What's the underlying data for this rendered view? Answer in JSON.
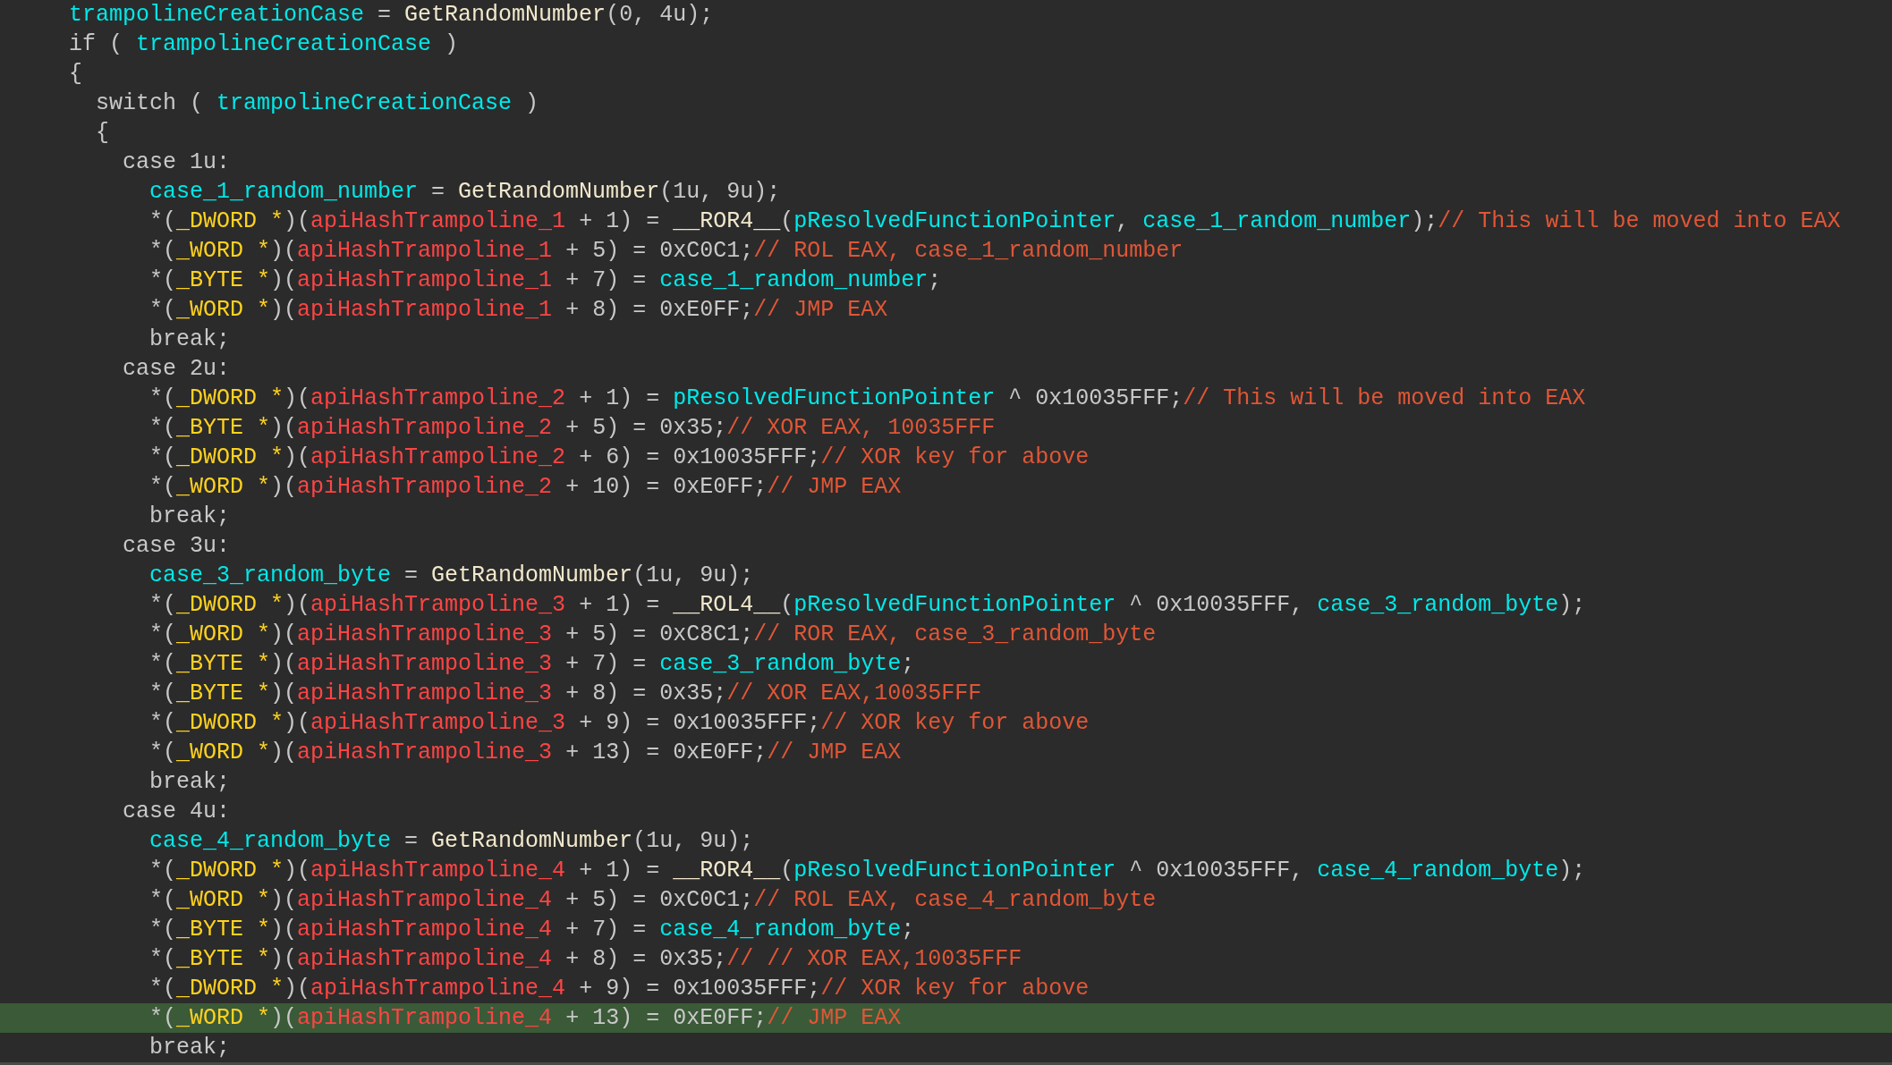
{
  "code_lines": [
    {
      "highlighted": false,
      "tokens": [
        {
          "kind": "var",
          "text": "trampolineCreationCase"
        },
        {
          "kind": "plain",
          "text": " = "
        },
        {
          "kind": "func",
          "text": "GetRandomNumber"
        },
        {
          "kind": "plain",
          "text": "(0, 4u);"
        }
      ]
    },
    {
      "highlighted": false,
      "tokens": [
        {
          "kind": "plain",
          "text": "if ( "
        },
        {
          "kind": "var",
          "text": "trampolineCreationCase"
        },
        {
          "kind": "plain",
          "text": " )"
        }
      ]
    },
    {
      "highlighted": false,
      "tokens": [
        {
          "kind": "plain",
          "text": "{"
        }
      ],
      "children": [
        {
          "highlighted": false,
          "tokens": [
            {
              "kind": "plain",
              "text": "switch ( "
            },
            {
              "kind": "var",
              "text": "trampolineCreationCase"
            },
            {
              "kind": "plain",
              "text": " )"
            }
          ]
        },
        {
          "highlighted": false,
          "tokens": [
            {
              "kind": "plain",
              "text": "{"
            }
          ],
          "children": [
            {
              "highlighted": false,
              "tokens": [
                {
                  "kind": "plain",
                  "text": "case 1u:"
                }
              ],
              "children": [
                {
                  "highlighted": false,
                  "tokens": [
                    {
                      "kind": "var",
                      "text": "case_1_random_number"
                    },
                    {
                      "kind": "plain",
                      "text": " = "
                    },
                    {
                      "kind": "func",
                      "text": "GetRandomNumber"
                    },
                    {
                      "kind": "plain",
                      "text": "(1u, 9u);"
                    }
                  ]
                },
                {
                  "highlighted": false,
                  "tokens": [
                    {
                      "kind": "plain",
                      "text": "*("
                    },
                    {
                      "kind": "type",
                      "text": "_DWORD *"
                    },
                    {
                      "kind": "plain",
                      "text": ")("
                    },
                    {
                      "kind": "global",
                      "text": "apiHashTrampoline_1"
                    },
                    {
                      "kind": "plain",
                      "text": " + 1) = "
                    },
                    {
                      "kind": "func",
                      "text": "__ROR4__"
                    },
                    {
                      "kind": "plain",
                      "text": "("
                    },
                    {
                      "kind": "var",
                      "text": "pResolvedFunctionPointer"
                    },
                    {
                      "kind": "plain",
                      "text": ", "
                    },
                    {
                      "kind": "var",
                      "text": "case_1_random_number"
                    },
                    {
                      "kind": "plain",
                      "text": ");"
                    },
                    {
                      "kind": "comment",
                      "text": "// This will be moved into EAX"
                    }
                  ]
                },
                {
                  "highlighted": false,
                  "tokens": [
                    {
                      "kind": "plain",
                      "text": "*("
                    },
                    {
                      "kind": "type",
                      "text": "_WORD *"
                    },
                    {
                      "kind": "plain",
                      "text": ")("
                    },
                    {
                      "kind": "global",
                      "text": "apiHashTrampoline_1"
                    },
                    {
                      "kind": "plain",
                      "text": " + 5) = 0xC0C1;"
                    },
                    {
                      "kind": "comment",
                      "text": "// ROL EAX, case_1_random_number"
                    }
                  ]
                },
                {
                  "highlighted": false,
                  "tokens": [
                    {
                      "kind": "plain",
                      "text": "*("
                    },
                    {
                      "kind": "type",
                      "text": "_BYTE *"
                    },
                    {
                      "kind": "plain",
                      "text": ")("
                    },
                    {
                      "kind": "global",
                      "text": "apiHashTrampoline_1"
                    },
                    {
                      "kind": "plain",
                      "text": " + 7) = "
                    },
                    {
                      "kind": "var",
                      "text": "case_1_random_number"
                    },
                    {
                      "kind": "plain",
                      "text": ";"
                    }
                  ]
                },
                {
                  "highlighted": false,
                  "tokens": [
                    {
                      "kind": "plain",
                      "text": "*("
                    },
                    {
                      "kind": "type",
                      "text": "_WORD *"
                    },
                    {
                      "kind": "plain",
                      "text": ")("
                    },
                    {
                      "kind": "global",
                      "text": "apiHashTrampoline_1"
                    },
                    {
                      "kind": "plain",
                      "text": " + 8) = 0xE0FF;"
                    },
                    {
                      "kind": "comment",
                      "text": "// JMP EAX"
                    }
                  ]
                },
                {
                  "highlighted": false,
                  "tokens": [
                    {
                      "kind": "plain",
                      "text": "break;"
                    }
                  ]
                }
              ]
            },
            {
              "highlighted": false,
              "tokens": [
                {
                  "kind": "plain",
                  "text": "case 2u:"
                }
              ],
              "children": [
                {
                  "highlighted": false,
                  "tokens": [
                    {
                      "kind": "plain",
                      "text": "*("
                    },
                    {
                      "kind": "type",
                      "text": "_DWORD *"
                    },
                    {
                      "kind": "plain",
                      "text": ")("
                    },
                    {
                      "kind": "global",
                      "text": "apiHashTrampoline_2"
                    },
                    {
                      "kind": "plain",
                      "text": " + 1) = "
                    },
                    {
                      "kind": "var",
                      "text": "pResolvedFunctionPointer"
                    },
                    {
                      "kind": "plain",
                      "text": " ^ 0x10035FFF;"
                    },
                    {
                      "kind": "comment",
                      "text": "// This will be moved into EAX"
                    }
                  ]
                },
                {
                  "highlighted": false,
                  "tokens": [
                    {
                      "kind": "plain",
                      "text": "*("
                    },
                    {
                      "kind": "type",
                      "text": "_BYTE *"
                    },
                    {
                      "kind": "plain",
                      "text": ")("
                    },
                    {
                      "kind": "global",
                      "text": "apiHashTrampoline_2"
                    },
                    {
                      "kind": "plain",
                      "text": " + 5) = 0x35;"
                    },
                    {
                      "kind": "comment",
                      "text": "// XOR EAX, 10035FFF"
                    }
                  ]
                },
                {
                  "highlighted": false,
                  "tokens": [
                    {
                      "kind": "plain",
                      "text": "*("
                    },
                    {
                      "kind": "type",
                      "text": "_DWORD *"
                    },
                    {
                      "kind": "plain",
                      "text": ")("
                    },
                    {
                      "kind": "global",
                      "text": "apiHashTrampoline_2"
                    },
                    {
                      "kind": "plain",
                      "text": " + 6) = 0x10035FFF;"
                    },
                    {
                      "kind": "comment",
                      "text": "// XOR key for above"
                    }
                  ]
                },
                {
                  "highlighted": false,
                  "tokens": [
                    {
                      "kind": "plain",
                      "text": "*("
                    },
                    {
                      "kind": "type",
                      "text": "_WORD *"
                    },
                    {
                      "kind": "plain",
                      "text": ")("
                    },
                    {
                      "kind": "global",
                      "text": "apiHashTrampoline_2"
                    },
                    {
                      "kind": "plain",
                      "text": " + 10) = 0xE0FF;"
                    },
                    {
                      "kind": "comment",
                      "text": "// JMP EAX"
                    }
                  ]
                },
                {
                  "highlighted": false,
                  "tokens": [
                    {
                      "kind": "plain",
                      "text": "break;"
                    }
                  ]
                }
              ]
            },
            {
              "highlighted": false,
              "tokens": [
                {
                  "kind": "plain",
                  "text": "case 3u:"
                }
              ],
              "children": [
                {
                  "highlighted": false,
                  "tokens": [
                    {
                      "kind": "var",
                      "text": "case_3_random_byte"
                    },
                    {
                      "kind": "plain",
                      "text": " = "
                    },
                    {
                      "kind": "func",
                      "text": "GetRandomNumber"
                    },
                    {
                      "kind": "plain",
                      "text": "(1u, 9u);"
                    }
                  ]
                },
                {
                  "highlighted": false,
                  "tokens": [
                    {
                      "kind": "plain",
                      "text": "*("
                    },
                    {
                      "kind": "type",
                      "text": "_DWORD *"
                    },
                    {
                      "kind": "plain",
                      "text": ")("
                    },
                    {
                      "kind": "global",
                      "text": "apiHashTrampoline_3"
                    },
                    {
                      "kind": "plain",
                      "text": " + 1) = "
                    },
                    {
                      "kind": "func",
                      "text": "__ROL4__"
                    },
                    {
                      "kind": "plain",
                      "text": "("
                    },
                    {
                      "kind": "var",
                      "text": "pResolvedFunctionPointer"
                    },
                    {
                      "kind": "plain",
                      "text": " ^ 0x10035FFF, "
                    },
                    {
                      "kind": "var",
                      "text": "case_3_random_byte"
                    },
                    {
                      "kind": "plain",
                      "text": ");"
                    }
                  ]
                },
                {
                  "highlighted": false,
                  "tokens": [
                    {
                      "kind": "plain",
                      "text": "*("
                    },
                    {
                      "kind": "type",
                      "text": "_WORD *"
                    },
                    {
                      "kind": "plain",
                      "text": ")("
                    },
                    {
                      "kind": "global",
                      "text": "apiHashTrampoline_3"
                    },
                    {
                      "kind": "plain",
                      "text": " + 5) = 0xC8C1;"
                    },
                    {
                      "kind": "comment",
                      "text": "// ROR EAX, case_3_random_byte"
                    }
                  ]
                },
                {
                  "highlighted": false,
                  "tokens": [
                    {
                      "kind": "plain",
                      "text": "*("
                    },
                    {
                      "kind": "type",
                      "text": "_BYTE *"
                    },
                    {
                      "kind": "plain",
                      "text": ")("
                    },
                    {
                      "kind": "global",
                      "text": "apiHashTrampoline_3"
                    },
                    {
                      "kind": "plain",
                      "text": " + 7) = "
                    },
                    {
                      "kind": "var",
                      "text": "case_3_random_byte"
                    },
                    {
                      "kind": "plain",
                      "text": ";"
                    }
                  ]
                },
                {
                  "highlighted": false,
                  "tokens": [
                    {
                      "kind": "plain",
                      "text": "*("
                    },
                    {
                      "kind": "type",
                      "text": "_BYTE *"
                    },
                    {
                      "kind": "plain",
                      "text": ")("
                    },
                    {
                      "kind": "global",
                      "text": "apiHashTrampoline_3"
                    },
                    {
                      "kind": "plain",
                      "text": " + 8) = 0x35;"
                    },
                    {
                      "kind": "comment",
                      "text": "// XOR EAX,10035FFF"
                    }
                  ]
                },
                {
                  "highlighted": false,
                  "tokens": [
                    {
                      "kind": "plain",
                      "text": "*("
                    },
                    {
                      "kind": "type",
                      "text": "_DWORD *"
                    },
                    {
                      "kind": "plain",
                      "text": ")("
                    },
                    {
                      "kind": "global",
                      "text": "apiHashTrampoline_3"
                    },
                    {
                      "kind": "plain",
                      "text": " + 9) = 0x10035FFF;"
                    },
                    {
                      "kind": "comment",
                      "text": "// XOR key for above"
                    }
                  ]
                },
                {
                  "highlighted": false,
                  "tokens": [
                    {
                      "kind": "plain",
                      "text": "*("
                    },
                    {
                      "kind": "type",
                      "text": "_WORD *"
                    },
                    {
                      "kind": "plain",
                      "text": ")("
                    },
                    {
                      "kind": "global",
                      "text": "apiHashTrampoline_3"
                    },
                    {
                      "kind": "plain",
                      "text": " + 13) = 0xE0FF;"
                    },
                    {
                      "kind": "comment",
                      "text": "// JMP EAX"
                    }
                  ]
                },
                {
                  "highlighted": false,
                  "tokens": [
                    {
                      "kind": "plain",
                      "text": "break;"
                    }
                  ]
                }
              ]
            },
            {
              "highlighted": false,
              "tokens": [
                {
                  "kind": "plain",
                  "text": "case 4u:"
                }
              ],
              "children": [
                {
                  "highlighted": false,
                  "tokens": [
                    {
                      "kind": "var",
                      "text": "case_4_random_byte"
                    },
                    {
                      "kind": "plain",
                      "text": " = "
                    },
                    {
                      "kind": "func",
                      "text": "GetRandomNumber"
                    },
                    {
                      "kind": "plain",
                      "text": "(1u, 9u);"
                    }
                  ]
                },
                {
                  "highlighted": false,
                  "tokens": [
                    {
                      "kind": "plain",
                      "text": "*("
                    },
                    {
                      "kind": "type",
                      "text": "_DWORD *"
                    },
                    {
                      "kind": "plain",
                      "text": ")("
                    },
                    {
                      "kind": "global",
                      "text": "apiHashTrampoline_4"
                    },
                    {
                      "kind": "plain",
                      "text": " + 1) = "
                    },
                    {
                      "kind": "func",
                      "text": "__ROR4__"
                    },
                    {
                      "kind": "plain",
                      "text": "("
                    },
                    {
                      "kind": "var",
                      "text": "pResolvedFunctionPointer"
                    },
                    {
                      "kind": "plain",
                      "text": " ^ 0x10035FFF, "
                    },
                    {
                      "kind": "var",
                      "text": "case_4_random_byte"
                    },
                    {
                      "kind": "plain",
                      "text": ");"
                    }
                  ]
                },
                {
                  "highlighted": false,
                  "tokens": [
                    {
                      "kind": "plain",
                      "text": "*("
                    },
                    {
                      "kind": "type",
                      "text": "_WORD *"
                    },
                    {
                      "kind": "plain",
                      "text": ")("
                    },
                    {
                      "kind": "global",
                      "text": "apiHashTrampoline_4"
                    },
                    {
                      "kind": "plain",
                      "text": " + 5) = 0xC0C1;"
                    },
                    {
                      "kind": "comment",
                      "text": "// ROL EAX, case_4_random_byte"
                    }
                  ]
                },
                {
                  "highlighted": false,
                  "tokens": [
                    {
                      "kind": "plain",
                      "text": "*("
                    },
                    {
                      "kind": "type",
                      "text": "_BYTE *"
                    },
                    {
                      "kind": "plain",
                      "text": ")("
                    },
                    {
                      "kind": "global",
                      "text": "apiHashTrampoline_4"
                    },
                    {
                      "kind": "plain",
                      "text": " + 7) = "
                    },
                    {
                      "kind": "var",
                      "text": "case_4_random_byte"
                    },
                    {
                      "kind": "plain",
                      "text": ";"
                    }
                  ]
                },
                {
                  "highlighted": false,
                  "tokens": [
                    {
                      "kind": "plain",
                      "text": "*("
                    },
                    {
                      "kind": "type",
                      "text": "_BYTE *"
                    },
                    {
                      "kind": "plain",
                      "text": ")("
                    },
                    {
                      "kind": "global",
                      "text": "apiHashTrampoline_4"
                    },
                    {
                      "kind": "plain",
                      "text": " + 8) = 0x35;"
                    },
                    {
                      "kind": "comment",
                      "text": "// // XOR EAX,10035FFF"
                    }
                  ]
                },
                {
                  "highlighted": false,
                  "tokens": [
                    {
                      "kind": "plain",
                      "text": "*("
                    },
                    {
                      "kind": "type",
                      "text": "_DWORD *"
                    },
                    {
                      "kind": "plain",
                      "text": ")("
                    },
                    {
                      "kind": "global",
                      "text": "apiHashTrampoline_4"
                    },
                    {
                      "kind": "plain",
                      "text": " + 9) = 0x10035FFF;"
                    },
                    {
                      "kind": "comment",
                      "text": "// XOR key for above"
                    }
                  ]
                },
                {
                  "highlighted": true,
                  "tokens": [
                    {
                      "kind": "plain",
                      "text": "*("
                    },
                    {
                      "kind": "type",
                      "text": "_WORD *"
                    },
                    {
                      "kind": "plain",
                      "text": ")("
                    },
                    {
                      "kind": "global",
                      "text": "apiHashTrampoline_4"
                    },
                    {
                      "kind": "plain",
                      "text": " + 13) = 0xE0FF;"
                    },
                    {
                      "kind": "comment",
                      "text": "// JMP EAX"
                    }
                  ]
                },
                {
                  "highlighted": false,
                  "tokens": [
                    {
                      "kind": "plain",
                      "text": "break;"
                    }
                  ]
                }
              ]
            }
          ]
        }
      ]
    }
  ]
}
